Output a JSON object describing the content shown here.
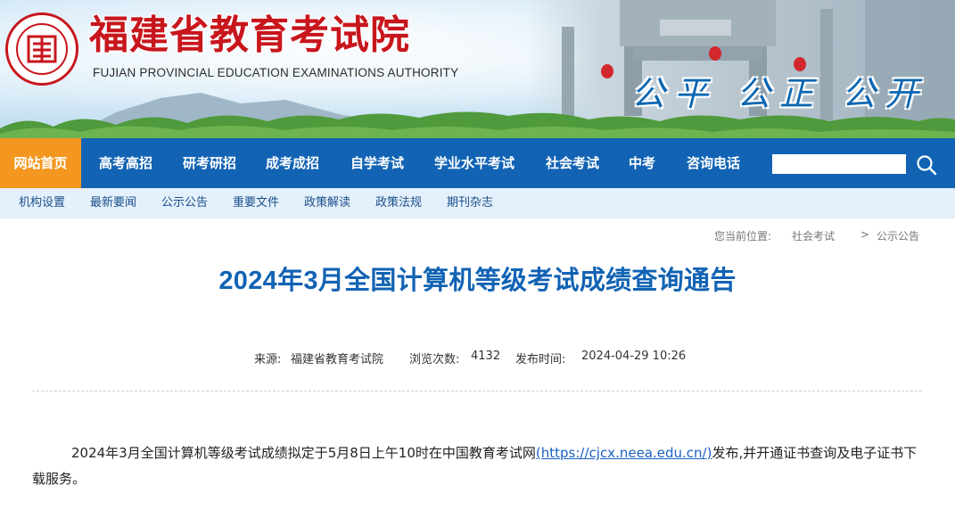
{
  "header": {
    "site_title": "福建省教育考试院",
    "site_subtitle": "FUJIAN PROVINCIAL EDUCATION EXAMINATIONS AUTHORITY",
    "slogan": "公平 公正 公开",
    "logo_icon": "exam-authority-seal-logo",
    "brand_red": "#c8161d",
    "brand_blue": "#1263b4"
  },
  "main_nav": {
    "active_color": "#f39720",
    "items": [
      {
        "label": "网站首页"
      },
      {
        "label": "高考高招"
      },
      {
        "label": "研考研招"
      },
      {
        "label": "成考成招"
      },
      {
        "label": "自学考试"
      },
      {
        "label": "学业水平考试"
      },
      {
        "label": "社会考试"
      },
      {
        "label": "中考"
      },
      {
        "label": "咨询电话"
      }
    ],
    "search": {
      "placeholder": "",
      "value": "",
      "icon": "search-icon"
    }
  },
  "sub_nav": {
    "items": [
      {
        "label": "机构设置"
      },
      {
        "label": "最新要闻"
      },
      {
        "label": "公示公告"
      },
      {
        "label": "重要文件"
      },
      {
        "label": "政策解读"
      },
      {
        "label": "政策法规"
      },
      {
        "label": "期刊杂志"
      }
    ]
  },
  "breadcrumb": {
    "prefix": "您当前位置:",
    "level1": "社会考试",
    "separator": ">",
    "level2": "公示公告"
  },
  "article": {
    "title": "2024年3月全国计算机等级考试成绩查询通告",
    "meta": {
      "source_label": "来源:",
      "source": "福建省教育考试院",
      "views_label": "浏览次数:",
      "views": "4132",
      "date_label": "发布时间:",
      "date": "2024-04-29 10:26"
    },
    "para_text_1": "2024年3月全国计算机等级考试成绩拟定于5月8日上午10时在中国教育考试网",
    "para_link": "(https://cjcx.neea.edu.cn/)",
    "para_text_2": "发布,并开通证书查询及电子证书下载服务。"
  }
}
